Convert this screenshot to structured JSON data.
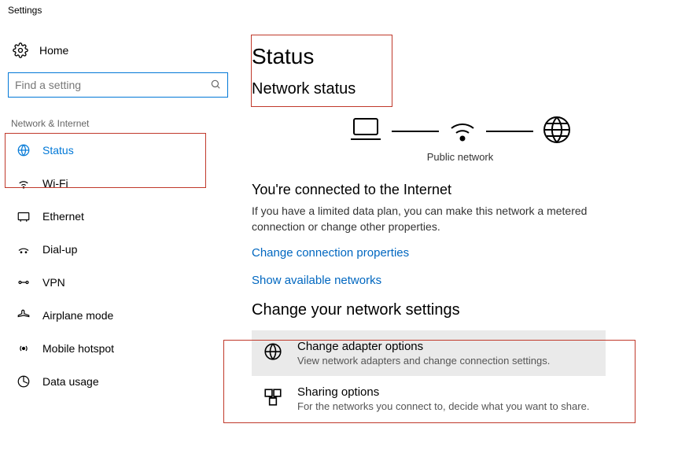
{
  "window_title": "Settings",
  "sidebar": {
    "home_label": "Home",
    "category_label": "Network & Internet",
    "nav": [
      {
        "label": "Status"
      },
      {
        "label": "Wi-Fi"
      },
      {
        "label": "Ethernet"
      },
      {
        "label": "Dial-up"
      },
      {
        "label": "VPN"
      },
      {
        "label": "Airplane mode"
      },
      {
        "label": "Mobile hotspot"
      },
      {
        "label": "Data usage"
      }
    ]
  },
  "search": {
    "placeholder": "Find a setting"
  },
  "main": {
    "title": "Status",
    "section": "Network status",
    "diagram_label": "Public network",
    "connected_heading": "You're connected to the Internet",
    "connected_desc": "If you have a limited data plan, you can make this network a metered connection or change other properties.",
    "link_change_props": "Change connection properties",
    "link_show_networks": "Show available networks",
    "change_heading": "Change your network settings",
    "tiles": [
      {
        "title": "Change adapter options",
        "sub": "View network adapters and change connection settings."
      },
      {
        "title": "Sharing options",
        "sub": "For the networks you connect to, decide what you want to share."
      }
    ]
  }
}
